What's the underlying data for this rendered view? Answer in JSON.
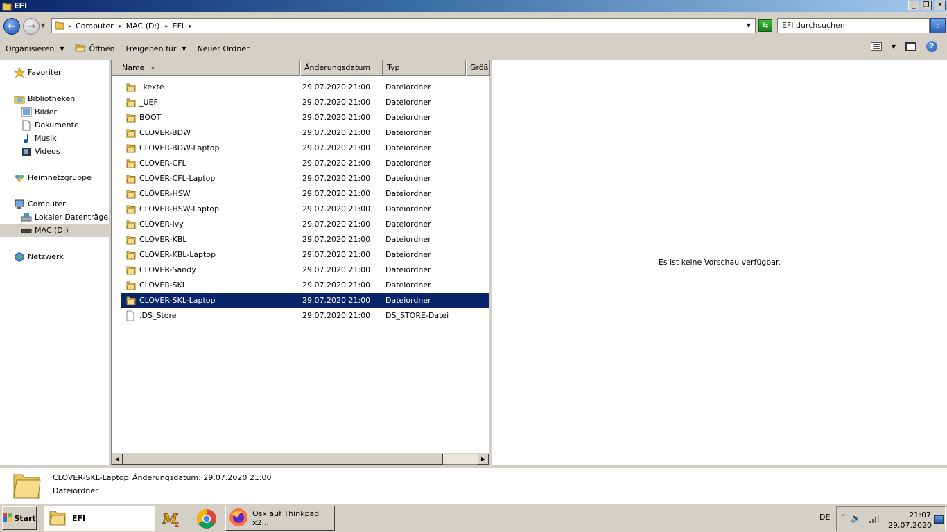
{
  "window": {
    "title": "EFI",
    "controls": {
      "minimize": "_",
      "maximize": "❐",
      "close": "✕"
    }
  },
  "address": {
    "crumbs": [
      "Computer",
      "MAC (D:)",
      "EFI"
    ],
    "search_placeholder": "EFI durchsuchen"
  },
  "toolbar": {
    "organize": "Organisieren",
    "open": "Öffnen",
    "share": "Freigeben für",
    "new_folder": "Neuer Ordner"
  },
  "nav": {
    "favorites": "Favoriten",
    "libraries": "Bibliotheken",
    "pictures": "Bilder",
    "documents": "Dokumente",
    "music": "Musik",
    "videos": "Videos",
    "homegroup": "Heimnetzgruppe",
    "computer": "Computer",
    "local_disk": "Lokaler Datenträger (C:)",
    "mac_drive": "MAC (D:)",
    "network": "Netzwerk"
  },
  "columns": {
    "name": "Name",
    "date": "Änderungsdatum",
    "type": "Typ",
    "size": "Größe"
  },
  "files": [
    {
      "name": "_kexte",
      "date": "29.07.2020 21:00",
      "type": "Dateiordner",
      "kind": "folder"
    },
    {
      "name": "_UEFI",
      "date": "29.07.2020 21:00",
      "type": "Dateiordner",
      "kind": "folder"
    },
    {
      "name": "BOOT",
      "date": "29.07.2020 21:00",
      "type": "Dateiordner",
      "kind": "folder"
    },
    {
      "name": "CLOVER-BDW",
      "date": "29.07.2020 21:00",
      "type": "Dateiordner",
      "kind": "folder"
    },
    {
      "name": "CLOVER-BDW-Laptop",
      "date": "29.07.2020 21:00",
      "type": "Dateiordner",
      "kind": "folder"
    },
    {
      "name": "CLOVER-CFL",
      "date": "29.07.2020 21:00",
      "type": "Dateiordner",
      "kind": "folder"
    },
    {
      "name": "CLOVER-CFL-Laptop",
      "date": "29.07.2020 21:00",
      "type": "Dateiordner",
      "kind": "folder"
    },
    {
      "name": "CLOVER-HSW",
      "date": "29.07.2020 21:00",
      "type": "Dateiordner",
      "kind": "folder"
    },
    {
      "name": "CLOVER-HSW-Laptop",
      "date": "29.07.2020 21:00",
      "type": "Dateiordner",
      "kind": "folder"
    },
    {
      "name": "CLOVER-Ivy",
      "date": "29.07.2020 21:00",
      "type": "Dateiordner",
      "kind": "folder"
    },
    {
      "name": "CLOVER-KBL",
      "date": "29.07.2020 21:00",
      "type": "Dateiordner",
      "kind": "folder"
    },
    {
      "name": "CLOVER-KBL-Laptop",
      "date": "29.07.2020 21:00",
      "type": "Dateiordner",
      "kind": "folder"
    },
    {
      "name": "CLOVER-Sandy",
      "date": "29.07.2020 21:00",
      "type": "Dateiordner",
      "kind": "folder"
    },
    {
      "name": "CLOVER-SKL",
      "date": "29.07.2020 21:00",
      "type": "Dateiordner",
      "kind": "folder"
    },
    {
      "name": "CLOVER-SKL-Laptop",
      "date": "29.07.2020 21:00",
      "type": "Dateiordner",
      "kind": "folder",
      "selected": true
    },
    {
      "name": ".DS_Store",
      "date": "29.07.2020 21:00",
      "type": "DS_STORE-Datei",
      "kind": "file"
    }
  ],
  "preview": {
    "message": "Es ist keine Vorschau verfügbar."
  },
  "details": {
    "name": "CLOVER-SKL-Laptop",
    "date_label": "Änderungsdatum: 29.07.2020 21:00",
    "type": "Dateiordner"
  },
  "taskbar": {
    "start": "Start",
    "active_window": "EFI",
    "firefox_window": "Osx auf Thinkpad x2...",
    "lang": "DE",
    "time": "21:07",
    "date": "29.07.2020"
  }
}
